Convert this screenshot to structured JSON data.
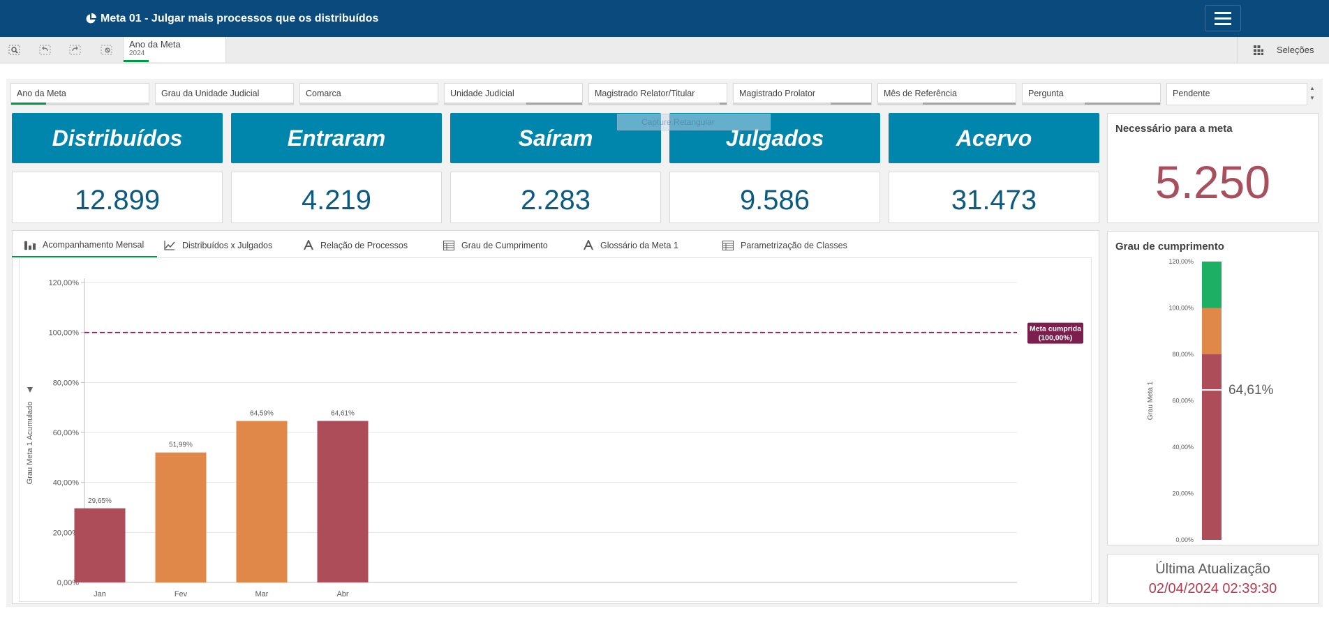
{
  "header": {
    "title": "Meta 01 - Julgar mais processos que os distribuídos"
  },
  "selection_bar": {
    "chip_label": "Ano da Meta",
    "chip_value": "2024",
    "selections_label": "Seleções"
  },
  "filters": [
    {
      "label": "Ano da Meta"
    },
    {
      "label": "Grau da Unidade Judicial"
    },
    {
      "label": "Comarca"
    },
    {
      "label": "Unidade Judicial"
    },
    {
      "label": "Magistrado Relator/Titular"
    },
    {
      "label": "Magistrado Prolator"
    },
    {
      "label": "Mês de Referência"
    },
    {
      "label": "Pergunta"
    },
    {
      "label": "Pendente"
    }
  ],
  "ghost_label": "Capture Retangular",
  "kpis": [
    {
      "label": "Distribuídos",
      "value": "12.899"
    },
    {
      "label": "Entraram",
      "value": "4.219"
    },
    {
      "label": "Saíram",
      "value": "2.283"
    },
    {
      "label": "Julgados",
      "value": "9.586"
    },
    {
      "label": "Acervo",
      "value": "31.473"
    }
  ],
  "necessario": {
    "title": "Necessário para a meta",
    "value": "5.250"
  },
  "tabs": [
    {
      "label": "Acompanhamento Mensal",
      "icon": "bar-chart-icon"
    },
    {
      "label": "Distribuídos x Julgados",
      "icon": "line-chart-icon"
    },
    {
      "label": "Relação de Processos",
      "icon": "text-a-icon"
    },
    {
      "label": "Grau de Cumprimento",
      "icon": "table-icon"
    },
    {
      "label": "Glossário da Meta 1",
      "icon": "text-a-icon"
    },
    {
      "label": "Parametrização de Classes",
      "icon": "table-icon"
    }
  ],
  "grau": {
    "title": "Grau de cumprimento"
  },
  "update": {
    "title": "Última Atualização",
    "value": "02/04/2024 02:39:30"
  },
  "colors": {
    "header": "#0b4a7d",
    "kpi": "#0086ad",
    "bar_red": "#ad4d5a",
    "bar_orange": "#e0874a",
    "gauge_green": "#1daf64",
    "meta_line": "#7d1f4e",
    "selection_green": "#009845"
  },
  "chart_data": [
    {
      "type": "bar",
      "categories": [
        "Jan",
        "Fev",
        "Mar",
        "Abr"
      ],
      "values": [
        29.65,
        51.99,
        64.59,
        64.61
      ],
      "value_labels": [
        "29,65%",
        "51,99%",
        "64,59%",
        "64,61%"
      ],
      "bar_colors": [
        "#ad4d5a",
        "#e0874a",
        "#e0874a",
        "#ad4d5a"
      ],
      "ylabel": "Grau Meta 1 Acumulado",
      "ylim": [
        0,
        120
      ],
      "yticks": [
        "0,00%",
        "20,00%",
        "40,00%",
        "60,00%",
        "80,00%",
        "100,00%",
        "120,00%"
      ],
      "reference_line": {
        "value": 100,
        "label_line1": "Meta cumprida",
        "label_line2": "(100,00%)"
      },
      "grid": true
    },
    {
      "type": "bar",
      "ylabel": "Grau Meta 1",
      "ylim": [
        0,
        120
      ],
      "yticks": [
        "0,00%",
        "20,00%",
        "40,00%",
        "60,00%",
        "80,00%",
        "100,00%",
        "120,00%"
      ],
      "bands": [
        {
          "from": 0,
          "to": 80,
          "color": "#ad4d5a"
        },
        {
          "from": 80,
          "to": 100,
          "color": "#e0874a"
        },
        {
          "from": 100,
          "to": 120,
          "color": "#1daf64"
        }
      ],
      "value": 64.61,
      "value_label": "64,61%"
    }
  ]
}
